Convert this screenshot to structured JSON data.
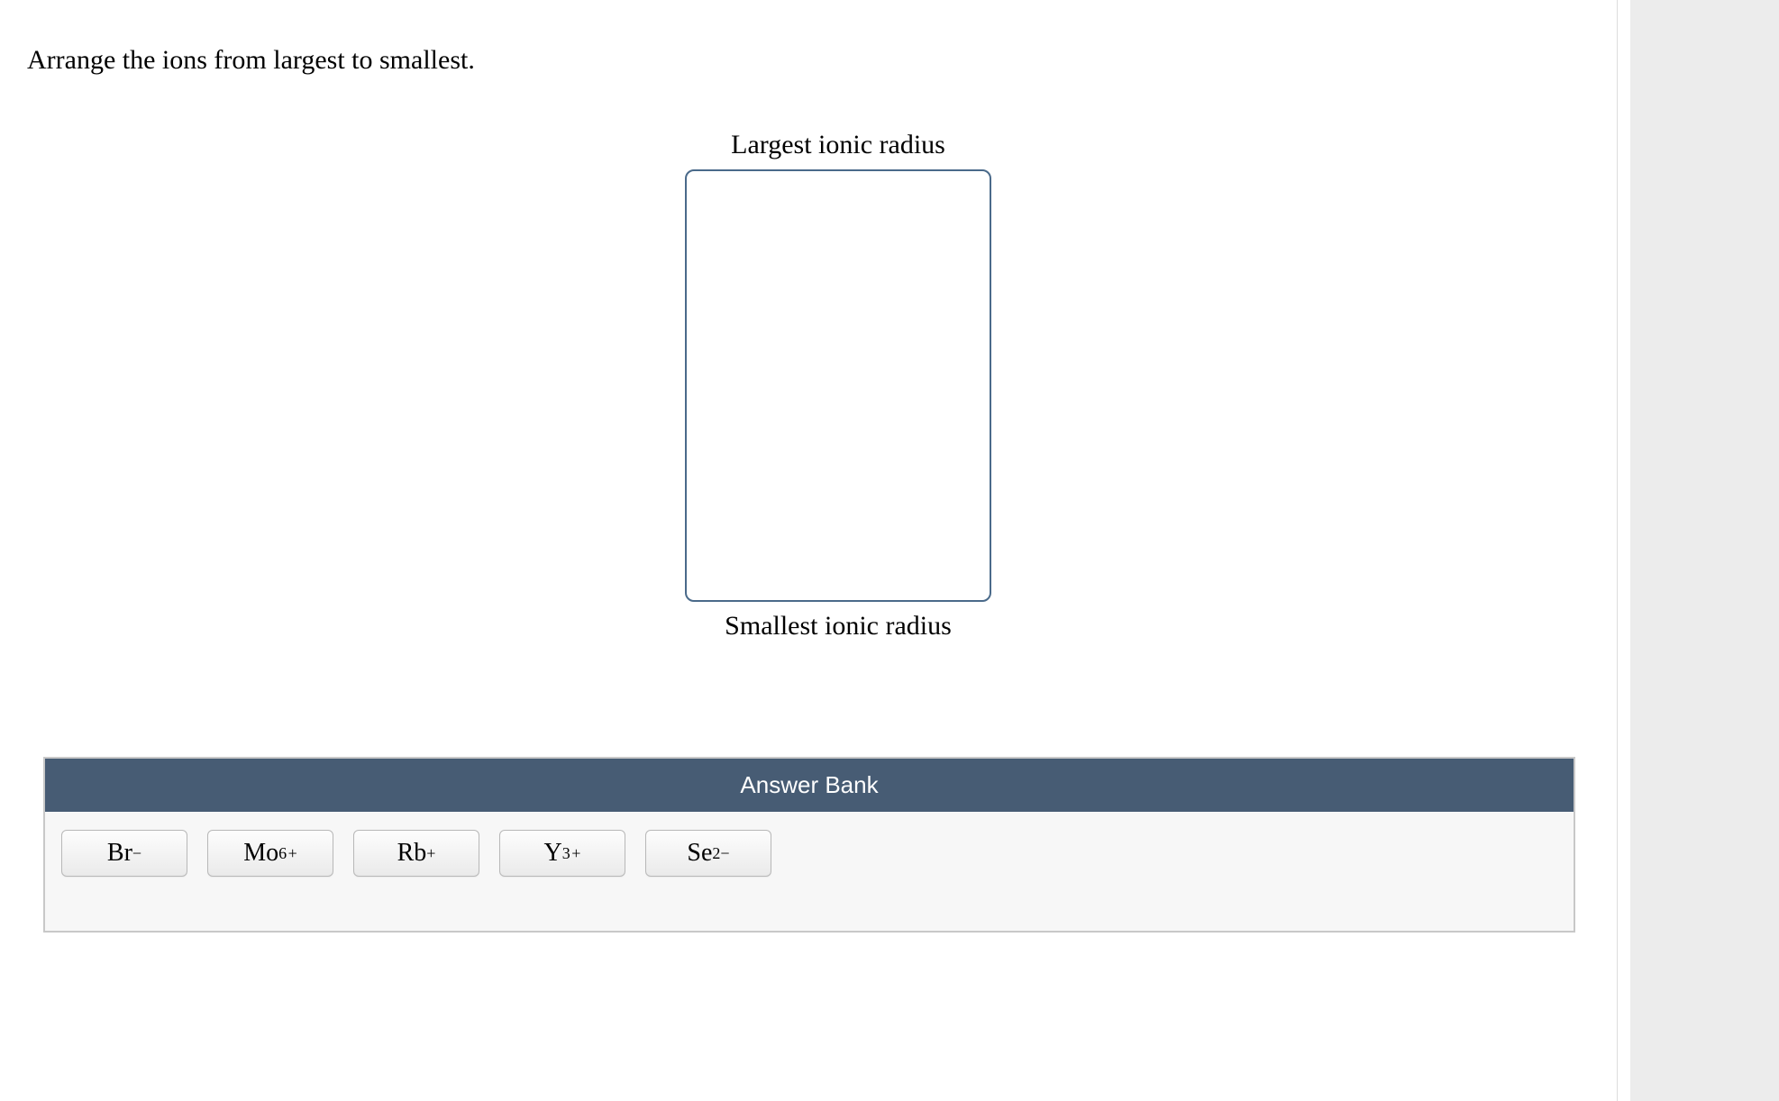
{
  "question": "Arrange the ions from largest to smallest.",
  "ranking": {
    "top_label": "Largest ionic radius",
    "bottom_label": "Smallest ionic radius"
  },
  "answer_bank": {
    "title": "Answer Bank",
    "ions": [
      {
        "element": "Br",
        "charge_num": "",
        "charge_sign": "−"
      },
      {
        "element": "Mo",
        "charge_num": "6",
        "charge_sign": "+"
      },
      {
        "element": "Rb",
        "charge_num": "",
        "charge_sign": "+"
      },
      {
        "element": "Y",
        "charge_num": "3",
        "charge_sign": "+"
      },
      {
        "element": "Se",
        "charge_num": "2",
        "charge_sign": "−"
      }
    ]
  }
}
